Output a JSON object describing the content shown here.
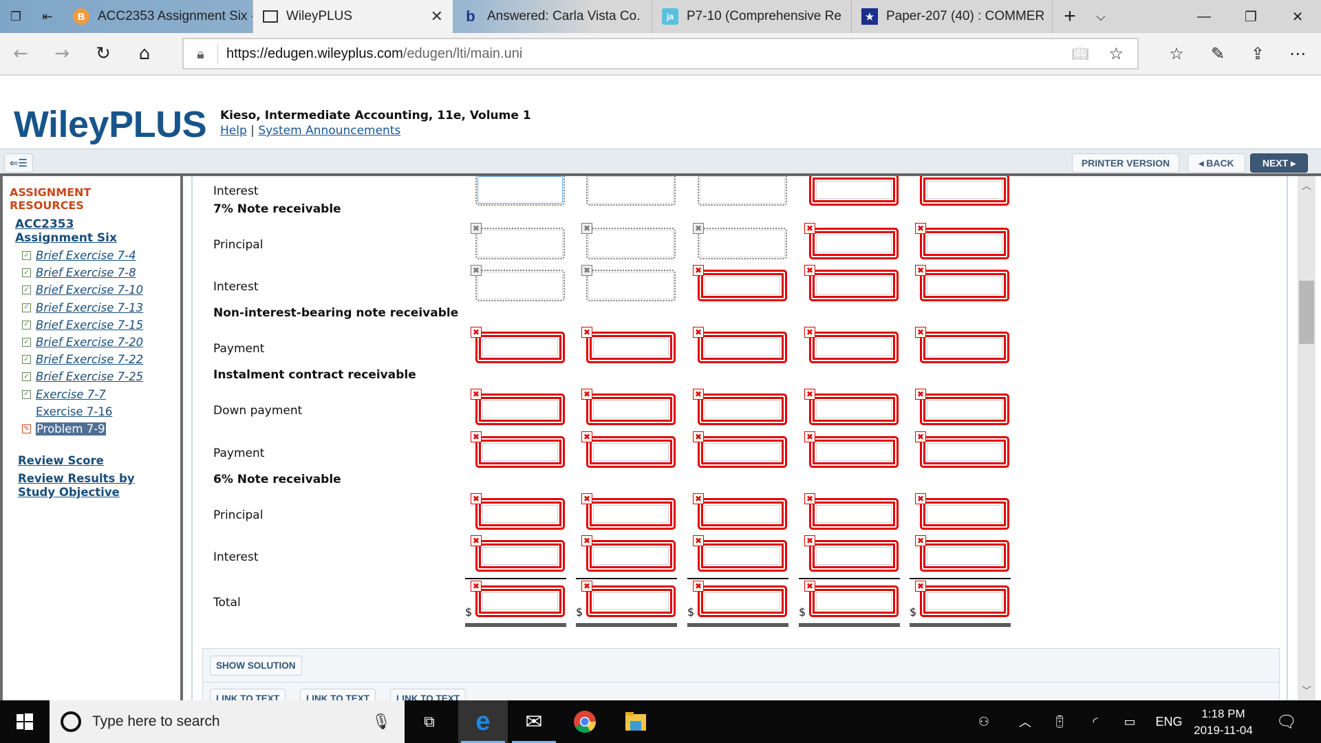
{
  "browser": {
    "tabs": [
      {
        "title": "ACC2353 Assignment Six -",
        "icon": "brightspace-icon"
      },
      {
        "title": "WileyPLUS",
        "icon": "page-icon",
        "active": true
      },
      {
        "title": "Answered: Carla Vista Co.",
        "icon": "bartleby-icon"
      },
      {
        "title": "P7-10 (Comprehensive Re",
        "icon": "jiskha-icon"
      },
      {
        "title": "Paper-207 (40) : COMMER",
        "icon": "bookmark-star-icon"
      }
    ],
    "url_host": "https://edugen.wileyplus.com",
    "url_path": "/edugen/lti/main.uni",
    "close_glyph": "✕"
  },
  "header": {
    "logo": "WileyPLUS",
    "book_title": "Kieso, Intermediate Accounting, 11e, Volume 1",
    "help_link": "Help",
    "separator": "|",
    "announcements_link": "System Announcements"
  },
  "toolbar": {
    "printer_label": "PRINTER VERSION",
    "back_label": "◂ BACK",
    "next_label": "NEXT ▸"
  },
  "sidebar": {
    "heading": "ASSIGNMENT RESOURCES",
    "assignment_link": "ACC2353 Assignment Six",
    "items": [
      {
        "label": "Brief Exercise 7-4",
        "status": "complete"
      },
      {
        "label": "Brief Exercise 7-8",
        "status": "complete"
      },
      {
        "label": "Brief Exercise 7-10",
        "status": "complete"
      },
      {
        "label": "Brief Exercise 7-13",
        "status": "complete"
      },
      {
        "label": "Brief Exercise 7-15",
        "status": "complete"
      },
      {
        "label": "Brief Exercise 7-20",
        "status": "complete"
      },
      {
        "label": "Brief Exercise 7-22",
        "status": "complete"
      },
      {
        "label": "Brief Exercise 7-25",
        "status": "complete"
      },
      {
        "label": "Exercise 7-7",
        "status": "complete"
      },
      {
        "label": "Exercise 7-16",
        "status": "none"
      },
      {
        "label": "Problem 7-9",
        "status": "in-progress",
        "current": true
      }
    ],
    "review_score": "Review Score",
    "review_results": "Review Results by Study Objective"
  },
  "worksheet": {
    "columns": 5,
    "rows": [
      {
        "label": "Interest",
        "type": "line",
        "cells": [
          "focus-dotted",
          "dotted",
          "dotted",
          "error",
          "error"
        ],
        "partial": true
      },
      {
        "label": "7% Note receivable",
        "type": "section"
      },
      {
        "label": "Principal",
        "type": "line",
        "cells": [
          "dotted",
          "dotted",
          "dotted",
          "error",
          "error"
        ]
      },
      {
        "label": "Interest",
        "type": "line",
        "cells": [
          "dotted",
          "dotted",
          "error",
          "error",
          "error"
        ]
      },
      {
        "label": "Non-interest-bearing note receivable",
        "type": "section"
      },
      {
        "label": "Payment",
        "type": "line",
        "cells": [
          "error",
          "error",
          "error",
          "error",
          "error"
        ]
      },
      {
        "label": "Instalment contract receivable",
        "type": "section"
      },
      {
        "label": "Down payment",
        "type": "line",
        "cells": [
          "error",
          "error",
          "error",
          "error",
          "error"
        ]
      },
      {
        "label": "Payment",
        "type": "line",
        "cells": [
          "error",
          "error",
          "error",
          "error",
          "error"
        ]
      },
      {
        "label": "6% Note receivable",
        "type": "section"
      },
      {
        "label": "Principal",
        "type": "line",
        "cells": [
          "error",
          "error",
          "error",
          "error",
          "error"
        ]
      },
      {
        "label": "Interest",
        "type": "line",
        "cells": [
          "error",
          "error",
          "error",
          "error",
          "error"
        ]
      },
      {
        "label": "Total",
        "type": "total",
        "cells": [
          "error",
          "error",
          "error",
          "error",
          "error"
        ],
        "currency": "$"
      }
    ],
    "values": [
      "",
      "",
      "",
      "",
      ""
    ],
    "error_mark": "✖",
    "dotted_mark": "✖"
  },
  "solution": {
    "show_solution_label": "SHOW SOLUTION",
    "link_labels": [
      "LINK TO TEXT",
      "LINK TO TEXT",
      "LINK TO TEXT"
    ]
  },
  "taskbar": {
    "search_placeholder": "Type here to search",
    "language": "ENG",
    "time": "1:18 PM",
    "date": "2019-11-04"
  }
}
